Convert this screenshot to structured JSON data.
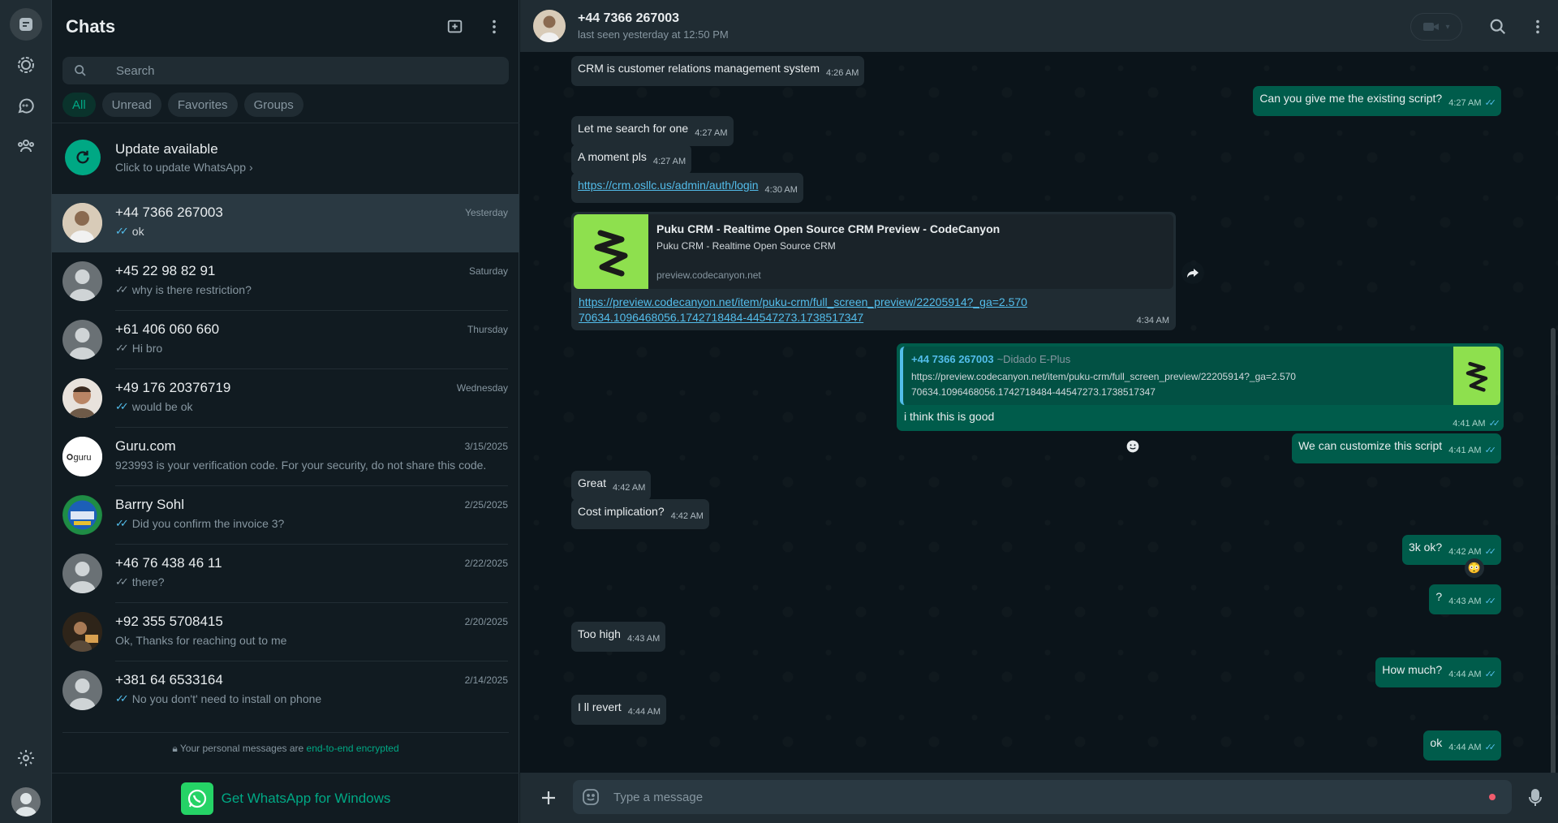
{
  "app": {
    "title": "WhatsApp"
  },
  "colors": {
    "accent": "#00a884",
    "outgoing_bubble": "#005c4b",
    "incoming_bubble": "#202c33",
    "read_tick": "#53bdeb"
  },
  "rail": {
    "items": [
      {
        "name": "chats",
        "icon": "chats-icon"
      },
      {
        "name": "status",
        "icon": "status-icon"
      },
      {
        "name": "channels",
        "icon": "channels-icon"
      },
      {
        "name": "communities",
        "icon": "communities-icon"
      },
      {
        "name": "settings",
        "icon": "gear-icon"
      },
      {
        "name": "profile",
        "icon": "avatar"
      }
    ]
  },
  "sidebar": {
    "title": "Chats",
    "search_placeholder": "Search",
    "filters": [
      "All",
      "Unread",
      "Favorites",
      "Groups"
    ],
    "update": {
      "title": "Update available",
      "subtitle": "Click to update WhatsApp ›"
    },
    "chats": [
      {
        "name": "+44 7366 267003",
        "time": "Yesterday",
        "preview": "ok",
        "tick": "read"
      },
      {
        "name": "+45 22 98 82 91",
        "time": "Saturday",
        "preview": "why is there restriction?",
        "tick": "sent"
      },
      {
        "name": "+61 406 060 660",
        "time": "Thursday",
        "preview": "Hi bro",
        "tick": "sent"
      },
      {
        "name": "+49 176 20376719",
        "time": "Wednesday",
        "preview": "would be  ok",
        "tick": "read"
      },
      {
        "name": "Guru.com",
        "time": "3/15/2025",
        "preview": "923993 is your verification code. For your security, do not share this code.",
        "tick": ""
      },
      {
        "name": "Barrry Sohl",
        "time": "2/25/2025",
        "preview": "Did you confirm the invoice 3?",
        "tick": "read"
      },
      {
        "name": "+46 76 438 46 11",
        "time": "2/22/2025",
        "preview": "there?",
        "tick": "sent"
      },
      {
        "name": "+92 355 5708415",
        "time": "2/20/2025",
        "preview": "Ok, Thanks for reaching out to me",
        "tick": ""
      },
      {
        "name": "+381 64 6533164",
        "time": "2/14/2025",
        "preview": "No you don't' need to install on phone",
        "tick": "read"
      }
    ],
    "e2e_text": "Your personal messages are ",
    "e2e_link": "end-to-end encrypted",
    "get_windows": "Get WhatsApp for Windows"
  },
  "conversation": {
    "name": "+44 7366 267003",
    "status": "last seen yesterday at 12:50 PM",
    "messages": [
      {
        "dir": "in",
        "text": "CRM is customer relations management system",
        "time": "4:26 AM"
      },
      {
        "dir": "out",
        "text": "Can you give me the existing script?",
        "time": "4:27 AM"
      },
      {
        "dir": "in",
        "text": "Let me search for one",
        "time": "4:27 AM"
      },
      {
        "dir": "in",
        "text": "A moment pls",
        "time": "4:27 AM"
      },
      {
        "dir": "in",
        "text": "https://crm.osllc.us/admin/auth/login",
        "time": "4:30 AM"
      },
      {
        "dir": "out",
        "text": "We can customize this script",
        "time": "4:41 AM"
      },
      {
        "dir": "in",
        "text": "Great",
        "time": "4:42 AM"
      },
      {
        "dir": "in",
        "text": "Cost implication?",
        "time": "4:42 AM"
      },
      {
        "dir": "out",
        "text": "3k ok?",
        "time": "4:42 AM"
      },
      {
        "dir": "out",
        "text": "?",
        "time": "4:43 AM"
      },
      {
        "dir": "in",
        "text": "Too high",
        "time": "4:43 AM"
      },
      {
        "dir": "out",
        "text": "How much?",
        "time": "4:44 AM"
      },
      {
        "dir": "in",
        "text": "I ll revert",
        "time": "4:44 AM"
      },
      {
        "dir": "out",
        "text": "ok",
        "time": "4:44 AM"
      }
    ],
    "link_card": {
      "title": "Puku CRM - Realtime Open Source CRM Preview - CodeCanyon",
      "description": "Puku CRM - Realtime Open Source CRM",
      "domain": "preview.codecanyon.net",
      "url": "https://preview.codecanyon.net/item/puku-crm/full_screen_preview/22205914?_ga=2.57070634.1096468056.1742718484-44547273.1738517347",
      "time": "4:34 AM"
    },
    "reply": {
      "quoted_sender": "+44 7366 267003",
      "quoted_alias": "~Didado E-Plus",
      "quoted_text": "https://preview.codecanyon.net/item/puku-crm/full_screen_preview/22205914?_ga=2.57070634.1096468056.1742718484-44547273.1738517347",
      "text": "i think this is good",
      "time": "4:41 AM"
    },
    "reaction": "😳",
    "composer_placeholder": "Type a message"
  }
}
